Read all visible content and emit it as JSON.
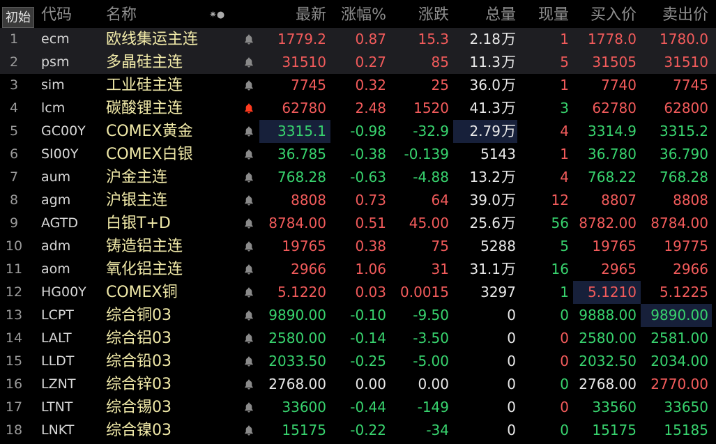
{
  "header": {
    "reset_label": "初始",
    "code": "代码",
    "name": "名称",
    "icons": "✷●",
    "latest": "最新",
    "pct": "涨幅%",
    "change": "涨跌",
    "total_volume": "总量",
    "current_volume": "现量",
    "bid": "买入价",
    "ask": "卖出价"
  },
  "colors": {
    "up": "#f25b5b",
    "down": "#38d36e",
    "flat": "#e8e8e8",
    "name": "#f0e9a8",
    "alert_active": "#ff3b1f"
  },
  "rows": [
    {
      "idx": "1",
      "code": "ecm",
      "name": "欧线集运主连",
      "alert": false,
      "latest": "1779.2",
      "pct": "0.87",
      "change": "15.3",
      "volume": "2.18",
      "unit": "万",
      "current": "1",
      "bid": "1778.0",
      "ask": "1780.0",
      "dir": "up",
      "bid_dir": "up",
      "ask_dir": "up",
      "cur_dir": "up",
      "selected": true
    },
    {
      "idx": "2",
      "code": "psm",
      "name": "多晶硅主连",
      "alert": false,
      "latest": "31510",
      "pct": "0.27",
      "change": "85",
      "volume": "11.3",
      "unit": "万",
      "current": "5",
      "bid": "31505",
      "ask": "31510",
      "dir": "up",
      "bid_dir": "up",
      "ask_dir": "up",
      "cur_dir": "up",
      "selected": true
    },
    {
      "idx": "3",
      "code": "sim",
      "name": "工业硅主连",
      "alert": false,
      "latest": "7745",
      "pct": "0.32",
      "change": "25",
      "volume": "36.0",
      "unit": "万",
      "current": "1",
      "bid": "7740",
      "ask": "7745",
      "dir": "up",
      "bid_dir": "up",
      "ask_dir": "up",
      "cur_dir": "up"
    },
    {
      "idx": "4",
      "code": "lcm",
      "name": "碳酸锂主连",
      "alert": true,
      "latest": "62780",
      "pct": "2.48",
      "change": "1520",
      "volume": "41.3",
      "unit": "万",
      "current": "3",
      "bid": "62780",
      "ask": "62800",
      "dir": "up",
      "bid_dir": "up",
      "ask_dir": "up",
      "cur_dir": "down"
    },
    {
      "idx": "5",
      "code": "GC00Y",
      "name": "COMEX黄金",
      "alert": false,
      "latest": "3315.1",
      "pct": "-0.98",
      "change": "-32.9",
      "volume": "2.79",
      "unit": "万",
      "current": "4",
      "bid": "3314.9",
      "ask": "3315.2",
      "dir": "down",
      "bid_dir": "down",
      "ask_dir": "down",
      "cur_dir": "up",
      "hl_latest": true,
      "hl_vol": true
    },
    {
      "idx": "6",
      "code": "SI00Y",
      "name": "COMEX白银",
      "alert": false,
      "latest": "36.785",
      "pct": "-0.38",
      "change": "-0.139",
      "volume": "5143",
      "unit": "",
      "current": "1",
      "bid": "36.780",
      "ask": "36.790",
      "dir": "down",
      "bid_dir": "down",
      "ask_dir": "down",
      "cur_dir": "up"
    },
    {
      "idx": "7",
      "code": "aum",
      "name": "沪金主连",
      "alert": false,
      "latest": "768.28",
      "pct": "-0.63",
      "change": "-4.88",
      "volume": "13.2",
      "unit": "万",
      "current": "4",
      "bid": "768.22",
      "ask": "768.28",
      "dir": "down",
      "bid_dir": "down",
      "ask_dir": "down",
      "cur_dir": "up"
    },
    {
      "idx": "8",
      "code": "agm",
      "name": "沪银主连",
      "alert": false,
      "latest": "8808",
      "pct": "0.73",
      "change": "64",
      "volume": "39.0",
      "unit": "万",
      "current": "12",
      "bid": "8807",
      "ask": "8808",
      "dir": "up",
      "bid_dir": "up",
      "ask_dir": "up",
      "cur_dir": "up"
    },
    {
      "idx": "9",
      "code": "AGTD",
      "name": "白银T+D",
      "alert": false,
      "latest": "8784.00",
      "pct": "0.51",
      "change": "45.00",
      "volume": "25.6",
      "unit": "万",
      "current": "56",
      "bid": "8782.00",
      "ask": "8784.00",
      "dir": "up",
      "bid_dir": "up",
      "ask_dir": "up",
      "cur_dir": "down"
    },
    {
      "idx": "10",
      "code": "adm",
      "name": "铸造铝主连",
      "alert": false,
      "latest": "19765",
      "pct": "0.38",
      "change": "75",
      "volume": "5288",
      "unit": "",
      "current": "5",
      "bid": "19765",
      "ask": "19775",
      "dir": "up",
      "bid_dir": "up",
      "ask_dir": "up",
      "cur_dir": "down"
    },
    {
      "idx": "11",
      "code": "aom",
      "name": "氧化铝主连",
      "alert": false,
      "latest": "2966",
      "pct": "1.06",
      "change": "31",
      "volume": "31.1",
      "unit": "万",
      "current": "16",
      "bid": "2965",
      "ask": "2966",
      "dir": "up",
      "bid_dir": "up",
      "ask_dir": "up",
      "cur_dir": "down"
    },
    {
      "idx": "12",
      "code": "HG00Y",
      "name": "COMEX铜",
      "alert": false,
      "latest": "5.1220",
      "pct": "0.03",
      "change": "0.0015",
      "volume": "3297",
      "unit": "",
      "current": "1",
      "bid": "5.1210",
      "ask": "5.1225",
      "dir": "up",
      "bid_dir": "up",
      "ask_dir": "up",
      "cur_dir": "down",
      "hl_bid": true
    },
    {
      "idx": "13",
      "code": "LCPT",
      "name": "综合铜03",
      "alert": false,
      "latest": "9890.00",
      "pct": "-0.10",
      "change": "-9.50",
      "volume": "0",
      "unit": "",
      "current": "0",
      "bid": "9888.00",
      "ask": "9890.00",
      "dir": "down",
      "bid_dir": "down",
      "ask_dir": "down",
      "cur_dir": "down",
      "hl_ask": true
    },
    {
      "idx": "14",
      "code": "LALT",
      "name": "综合铝03",
      "alert": false,
      "latest": "2580.00",
      "pct": "-0.14",
      "change": "-3.50",
      "volume": "0",
      "unit": "",
      "current": "0",
      "bid": "2580.00",
      "ask": "2581.00",
      "dir": "down",
      "bid_dir": "down",
      "ask_dir": "down",
      "cur_dir": "up"
    },
    {
      "idx": "15",
      "code": "LLDT",
      "name": "综合铅03",
      "alert": false,
      "latest": "2033.50",
      "pct": "-0.25",
      "change": "-5.00",
      "volume": "0",
      "unit": "",
      "current": "0",
      "bid": "2032.50",
      "ask": "2034.00",
      "dir": "down",
      "bid_dir": "down",
      "ask_dir": "down",
      "cur_dir": "up"
    },
    {
      "idx": "16",
      "code": "LZNT",
      "name": "综合锌03",
      "alert": false,
      "latest": "2768.00",
      "pct": "0.00",
      "change": "0.00",
      "volume": "0",
      "unit": "",
      "current": "0",
      "bid": "2768.00",
      "ask": "2770.00",
      "dir": "flat",
      "bid_dir": "flat",
      "ask_dir": "up",
      "cur_dir": "down"
    },
    {
      "idx": "17",
      "code": "LTNT",
      "name": "综合锡03",
      "alert": false,
      "latest": "33600",
      "pct": "-0.44",
      "change": "-149",
      "volume": "0",
      "unit": "",
      "current": "0",
      "bid": "33560",
      "ask": "33650",
      "dir": "down",
      "bid_dir": "down",
      "ask_dir": "down",
      "cur_dir": "up"
    },
    {
      "idx": "18",
      "code": "LNKT",
      "name": "综合镍03",
      "alert": false,
      "latest": "15175",
      "pct": "-0.22",
      "change": "-34",
      "volume": "0",
      "unit": "",
      "current": "0",
      "bid": "15175",
      "ask": "15185",
      "dir": "down",
      "bid_dir": "down",
      "ask_dir": "down",
      "cur_dir": "down"
    }
  ]
}
